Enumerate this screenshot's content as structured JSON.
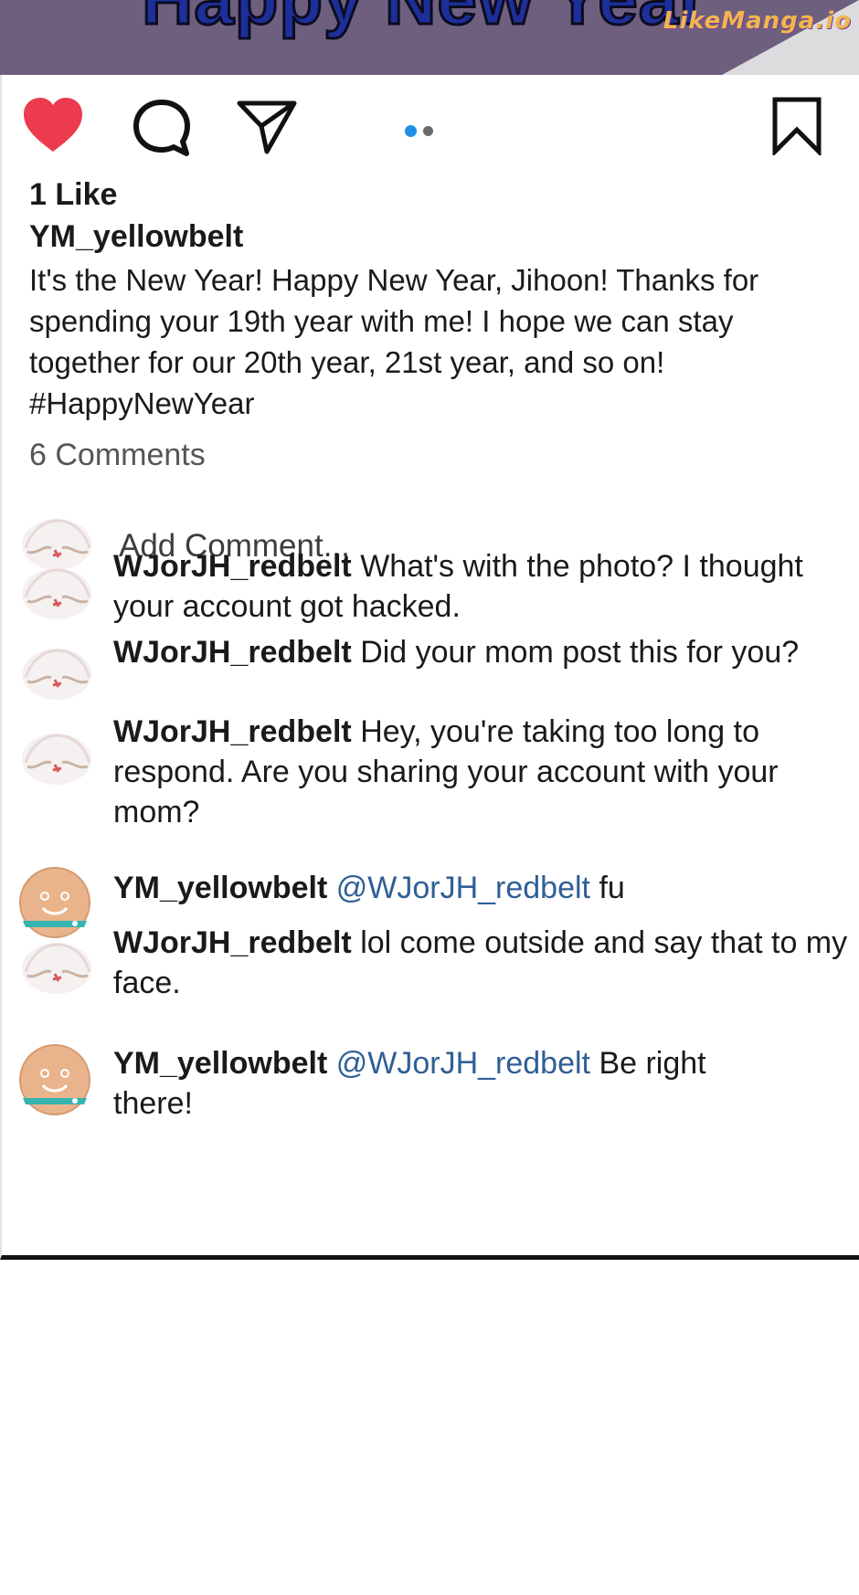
{
  "banner": {
    "title": "Happy New Year",
    "watermark": "LikeManga.io",
    "background": "#6e5f7f"
  },
  "post": {
    "actions": {
      "like_icon": "heart-filled-icon",
      "comment_icon": "speech-bubble-icon",
      "share_icon": "paper-plane-icon",
      "save_icon": "bookmark-icon",
      "like_color": "#ec3b4f"
    },
    "carousel": {
      "total": 2,
      "active": 1,
      "active_color": "#1f8fe5"
    },
    "likes": "1 Like",
    "author": "YM_yellowbelt",
    "caption": "It's the New Year! Happy New Year, Jihoon! Thanks for spending your 19th year with me! I hope we can stay together for our 20th year, 21st year, and so on! #HappyNewYear",
    "comment_count": "6 Comments"
  },
  "add_comment": {
    "placeholder": "Add Comment..."
  },
  "comments": [
    {
      "user": "WJorJH_redbelt",
      "mention": "",
      "text": "What's with the photo? I thought your account got hacked.",
      "avatar": "egg-avatar-icon"
    },
    {
      "user": "WJorJH_redbelt",
      "mention": "",
      "text": "Did your mom post this for you?",
      "avatar": "egg-avatar-icon"
    },
    {
      "user": "WJorJH_redbelt",
      "mention": "",
      "text": "Hey, you're taking too long to respond. Are you sharing your account with your mom?",
      "avatar": "egg-avatar-icon"
    },
    {
      "user": "YM_yellowbelt",
      "mention": "@WJorJH_redbelt",
      "text": "fu",
      "avatar": "smiley-avatar-icon"
    },
    {
      "user": "WJorJH_redbelt",
      "mention": "",
      "text": "lol come outside and say that to my face.",
      "avatar": "egg-avatar-icon"
    },
    {
      "user": "YM_yellowbelt",
      "mention": "@WJorJH_redbelt",
      "text": "Be right there!",
      "avatar": "smiley-avatar-icon"
    }
  ]
}
